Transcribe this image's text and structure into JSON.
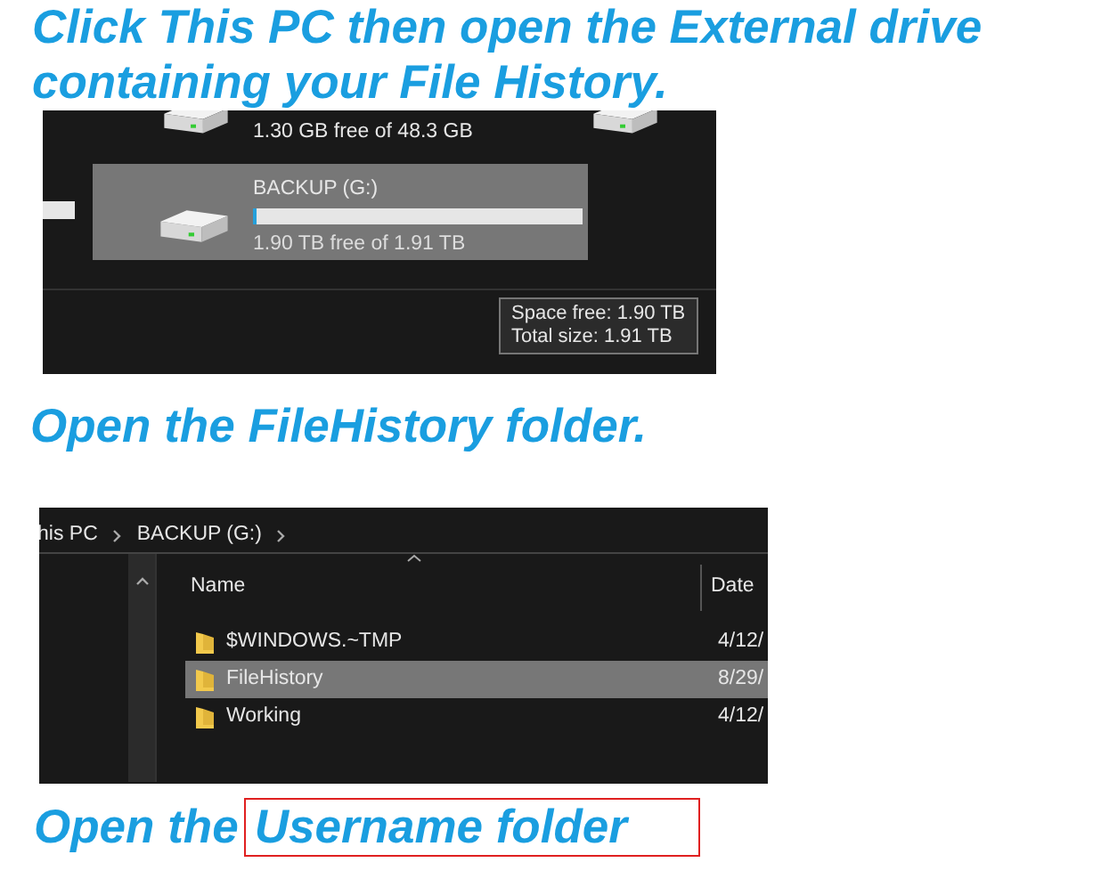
{
  "step_1": {
    "heading": "Click This PC then open the External drive containing your File History.",
    "screenshot": {
      "partial_drive": {
        "free_text": "1.30 GB free of 48.3 GB"
      },
      "drive": {
        "name": "BACKUP (G:)",
        "selected": true,
        "level": 0.01,
        "free_text": "1.90 TB free of 1.91 TB"
      },
      "tooltip": [
        "Space free: 1.90 TB",
        "Total size: 1.91 TB"
      ]
    }
  },
  "step_2": {
    "heading": "Open the FileHistory folder.",
    "screenshot": {
      "breadcrumb": [
        "his PC",
        "BACKUP (G:)"
      ],
      "columns": [
        "Name",
        "Date"
      ],
      "rows": [
        {
          "name": "$WINDOWS.~TMP",
          "date": "4/12/",
          "selected": false
        },
        {
          "name": "FileHistory",
          "date": "8/29/",
          "selected": true
        },
        {
          "name": "Working",
          "date": "4/12/",
          "selected": false
        }
      ]
    }
  },
  "step_3": {
    "heading": "Open the",
    "highlighted": "Username folder"
  }
}
